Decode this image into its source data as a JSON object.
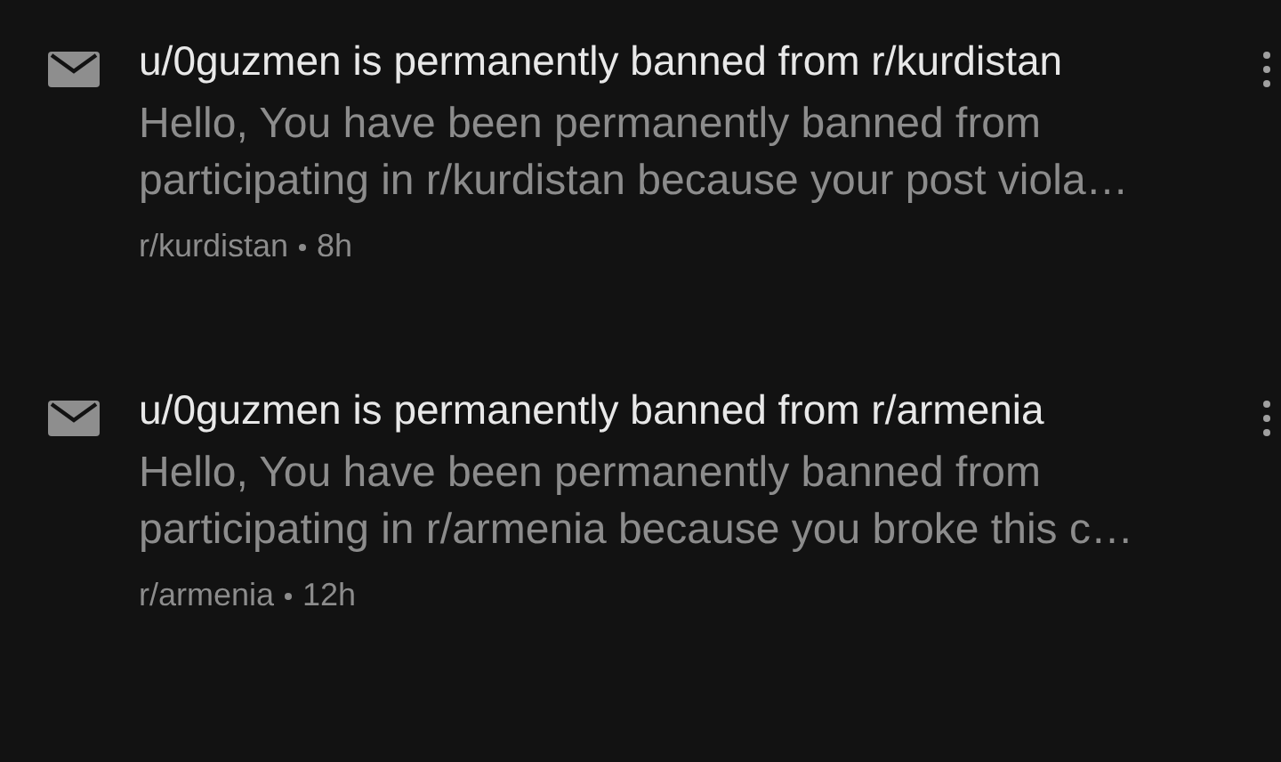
{
  "messages": [
    {
      "title": "u/0guzmen is permanently banned from r/kurdistan",
      "body": "Hello, You have been permanently banned from participating in r/kurdistan because your post viola…",
      "subreddit": "r/kurdistan",
      "time": "8h"
    },
    {
      "title": "u/0guzmen is permanently banned from r/armenia",
      "body": "Hello, You have been permanently banned from participating in r/armenia because you broke this c…",
      "subreddit": "r/armenia",
      "time": "12h"
    }
  ]
}
